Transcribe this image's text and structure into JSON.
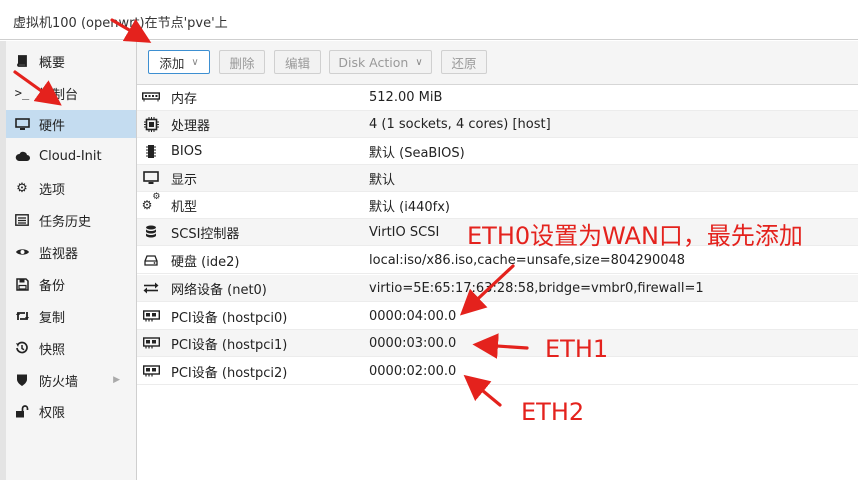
{
  "window": {
    "title": "虚拟机100 (openwrt)在节点'pve'上"
  },
  "sidebar": {
    "items": [
      {
        "label": "概要",
        "icon": "book-icon"
      },
      {
        "label": "控制台",
        "icon": "terminal-icon"
      },
      {
        "label": "硬件",
        "icon": "desktop-icon",
        "active": true
      },
      {
        "label": "Cloud-Init",
        "icon": "cloud-icon"
      },
      {
        "label": "选项",
        "icon": "gear-icon"
      },
      {
        "label": "任务历史",
        "icon": "list-icon"
      },
      {
        "label": "监视器",
        "icon": "eye-icon"
      },
      {
        "label": "备份",
        "icon": "floppy-icon"
      },
      {
        "label": "复制",
        "icon": "retweet-icon"
      },
      {
        "label": "快照",
        "icon": "history-icon"
      },
      {
        "label": "防火墙",
        "icon": "shield-icon"
      },
      {
        "label": "权限",
        "icon": "unlock-icon"
      }
    ]
  },
  "toolbar": {
    "add_label": "添加",
    "remove_label": "删除",
    "edit_label": "编辑",
    "disk_action_label": "Disk Action",
    "revert_label": "还原"
  },
  "hardware": {
    "rows": [
      {
        "key": "内存",
        "value": "512.00 MiB",
        "icon": "memory-icon"
      },
      {
        "key": "处理器",
        "value": "4 (1 sockets, 4 cores) [host]",
        "icon": "cpu-icon"
      },
      {
        "key": "BIOS",
        "value": "默认 (SeaBIOS)",
        "icon": "microchip-icon"
      },
      {
        "key": "显示",
        "value": "默认",
        "icon": "monitor-icon"
      },
      {
        "key": "机型",
        "value": "默认 (i440fx)",
        "icon": "cogs-icon"
      },
      {
        "key": "SCSI控制器",
        "value": "VirtIO SCSI",
        "icon": "database-icon"
      },
      {
        "key": "硬盘 (ide2)",
        "value": "local:iso/x86.iso,cache=unsafe,size=804290048",
        "icon": "hdd-icon"
      },
      {
        "key": "网络设备 (net0)",
        "value": "virtio=5E:65:17:63:28:58,bridge=vmbr0,firewall=1",
        "icon": "exchange-icon"
      },
      {
        "key": "PCI设备 (hostpci0)",
        "value": "0000:04:00.0",
        "icon": "pci-card-icon"
      },
      {
        "key": "PCI设备 (hostpci1)",
        "value": "0000:03:00.0",
        "icon": "pci-card-icon"
      },
      {
        "key": "PCI设备 (hostpci2)",
        "value": "0000:02:00.0",
        "icon": "pci-card-icon"
      }
    ]
  },
  "annotations": {
    "eth0": "ETH0设置为WAN口，最先添加",
    "eth1": "ETH1",
    "eth2": "ETH2",
    "color": "#e4221d"
  }
}
